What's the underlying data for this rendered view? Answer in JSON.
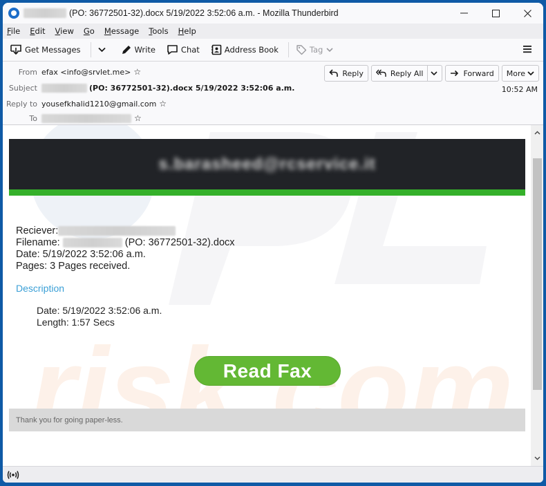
{
  "window": {
    "title_suffix": "(PO: 36772501-32).docx 5/19/2022 3:52:06 a.m. - Mozilla Thunderbird",
    "controls": {
      "minimize": "—",
      "maximize": "☐",
      "close": "✕"
    }
  },
  "menubar": {
    "items": [
      {
        "accel": "F",
        "rest": "ile"
      },
      {
        "accel": "E",
        "rest": "dit"
      },
      {
        "accel": "V",
        "rest": "iew"
      },
      {
        "accel": "G",
        "rest": "o"
      },
      {
        "accel": "M",
        "rest": "essage"
      },
      {
        "accel": "T",
        "rest": "ools"
      },
      {
        "accel": "H",
        "rest": "elp"
      }
    ]
  },
  "toolbar": {
    "get_messages": "Get Messages",
    "write": "Write",
    "chat": "Chat",
    "address_book": "Address Book",
    "tag": "Tag"
  },
  "header": {
    "from_label": "From",
    "from_value": "efax <info@srvlet.me>",
    "subject_label": "Subject",
    "subject_value": "(PO: 36772501-32).docx 5/19/2022 3:52:06 a.m.",
    "reply_to_label": "Reply to",
    "reply_to_value": "yousefkhalid1210@gmail.com",
    "to_label": "To",
    "time": "10:52 AM",
    "actions": {
      "reply": "Reply",
      "reply_all": "Reply All",
      "forward": "Forward",
      "more": "More"
    }
  },
  "message": {
    "banner_text": "s.barasheed@rcservice.it",
    "receiver_label": "Reciever:",
    "filename_label": "Filename:",
    "filename_suffix": "(PO: 36772501-32).docx",
    "date_line": "Date: 5/19/2022 3:52:06 a.m.",
    "pages_line": "Pages: 3 Pages received.",
    "description_heading": "Description",
    "desc_date_line": "Date: 5/19/2022 3:52:06 a.m.",
    "desc_length_line": "Length: 1:57 Secs",
    "read_fax_button": "Read Fax",
    "footer_text": "Thank you for going paper-less."
  },
  "colors": {
    "accent_green": "#63b834",
    "banner_dark": "#212327",
    "banner_stripe": "#35b02a",
    "description_link": "#3a9fd6",
    "window_frame": "#0f5aa6"
  }
}
